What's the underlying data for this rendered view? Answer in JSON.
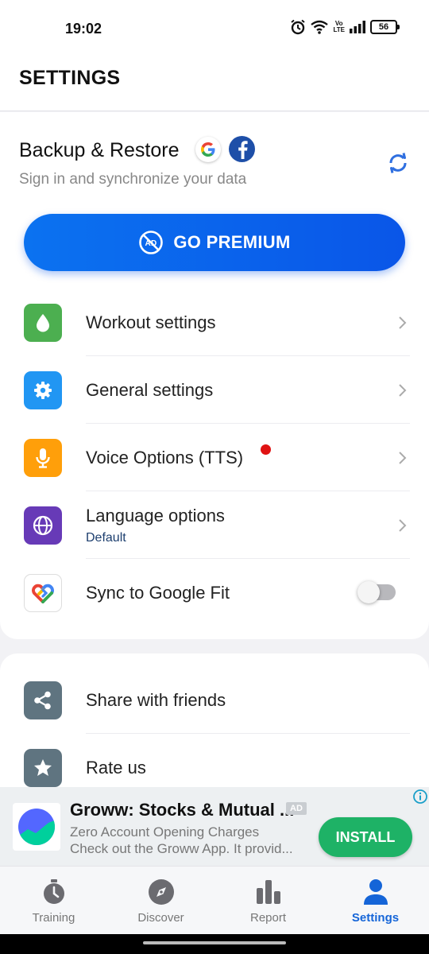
{
  "status_bar": {
    "time": "19:02",
    "battery": "56",
    "volte_top": "Vo",
    "volte_bottom": "LTE",
    "icons": [
      "alarm-icon",
      "wifi-icon",
      "signal-icon",
      "battery-icon"
    ]
  },
  "header": {
    "title": "SETTINGS"
  },
  "backup": {
    "title": "Backup & Restore",
    "subtitle": "Sign in and synchronize your data",
    "icons": [
      "google-icon",
      "facebook-icon",
      "sync-icon"
    ]
  },
  "premium": {
    "label": "GO PREMIUM",
    "icon": "no-ads-icon"
  },
  "menu": {
    "items": [
      {
        "label": "Workout settings",
        "icon": "drop-icon",
        "color": "#4caf50"
      },
      {
        "label": "General settings",
        "icon": "gear-icon",
        "color": "#2196f3"
      },
      {
        "label": "Voice Options (TTS)",
        "icon": "mic-icon",
        "color": "#ff9f0a",
        "dot_color": "#e01313"
      },
      {
        "label": "Language options",
        "sub": "Default",
        "icon": "globe-icon",
        "color": "#673ab7"
      },
      {
        "label": "Sync to Google Fit",
        "icon": "google-fit-icon",
        "toggle_on": false
      }
    ]
  },
  "social": {
    "items": [
      {
        "label": "Share with friends",
        "icon": "share-icon",
        "color": "#5f7480"
      },
      {
        "label": "Rate us",
        "icon": "star-icon",
        "color": "#5f7480"
      }
    ]
  },
  "ad": {
    "title": "Groww: Stocks & Mutual ...",
    "badge": "AD",
    "line1": "Zero Account Opening Charges",
    "line2": "Check out the Groww App. It provid...",
    "button": "INSTALL",
    "button_color": "#1eb266"
  },
  "bottom_nav": {
    "items": [
      {
        "label": "Training",
        "icon": "stopwatch-icon"
      },
      {
        "label": "Discover",
        "icon": "compass-icon"
      },
      {
        "label": "Report",
        "icon": "bar-chart-icon"
      },
      {
        "label": "Settings",
        "icon": "person-icon",
        "active": true
      }
    ],
    "active_color": "#1565d8"
  }
}
